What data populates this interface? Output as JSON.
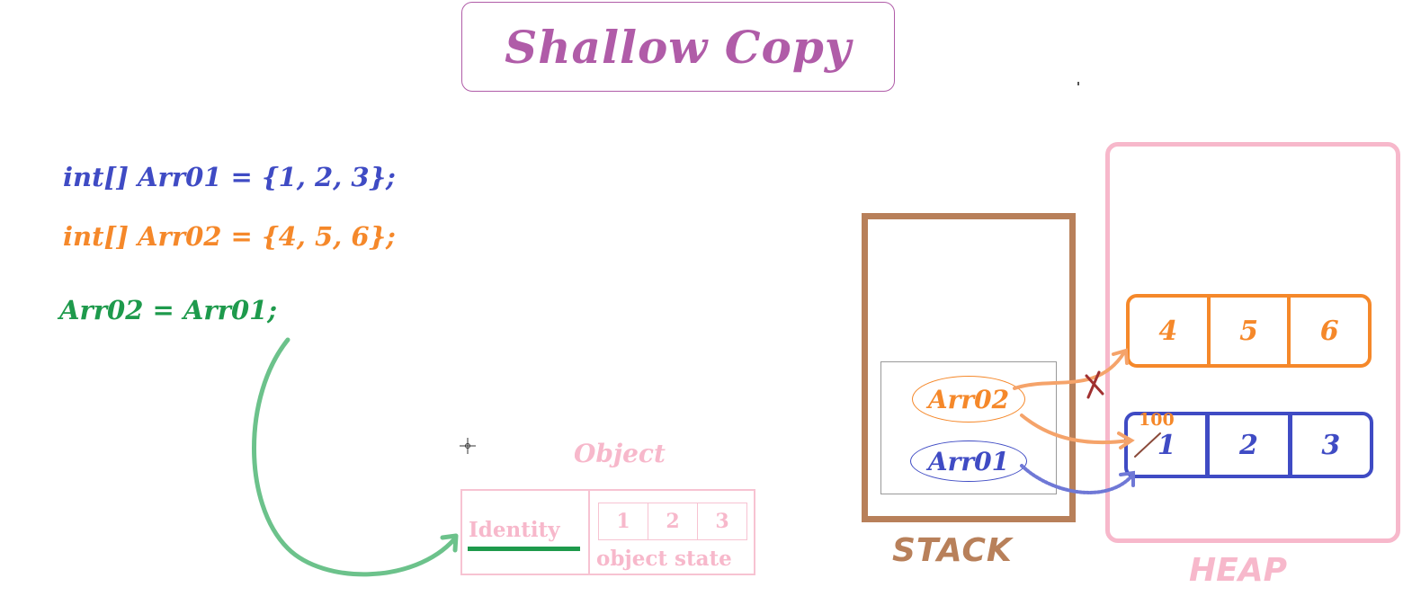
{
  "title": "Shallow Copy",
  "code": {
    "line1": "int[] Arr01 = {1, 2, 3};",
    "line2": "int[] Arr02 = {4, 5, 6};",
    "line3": "Arr02 = Arr01;"
  },
  "object": {
    "title": "Object",
    "identity": "Identity",
    "state_values": [
      "1",
      "2",
      "3"
    ],
    "state_label": "object state"
  },
  "stack": {
    "label": "STACK",
    "vars": [
      "Arr02",
      "Arr01"
    ]
  },
  "heap": {
    "label": "HEAP",
    "orange_array": [
      "4",
      "5",
      "6"
    ],
    "blue_array": [
      "1",
      "2",
      "3"
    ],
    "address": "100"
  },
  "colors": {
    "title": "#b05ca8",
    "blue": "#3f4bc4",
    "orange": "#f5882a",
    "green": "#1e9a4c",
    "pink": "#f7b8cb",
    "brown": "#b8805a"
  }
}
